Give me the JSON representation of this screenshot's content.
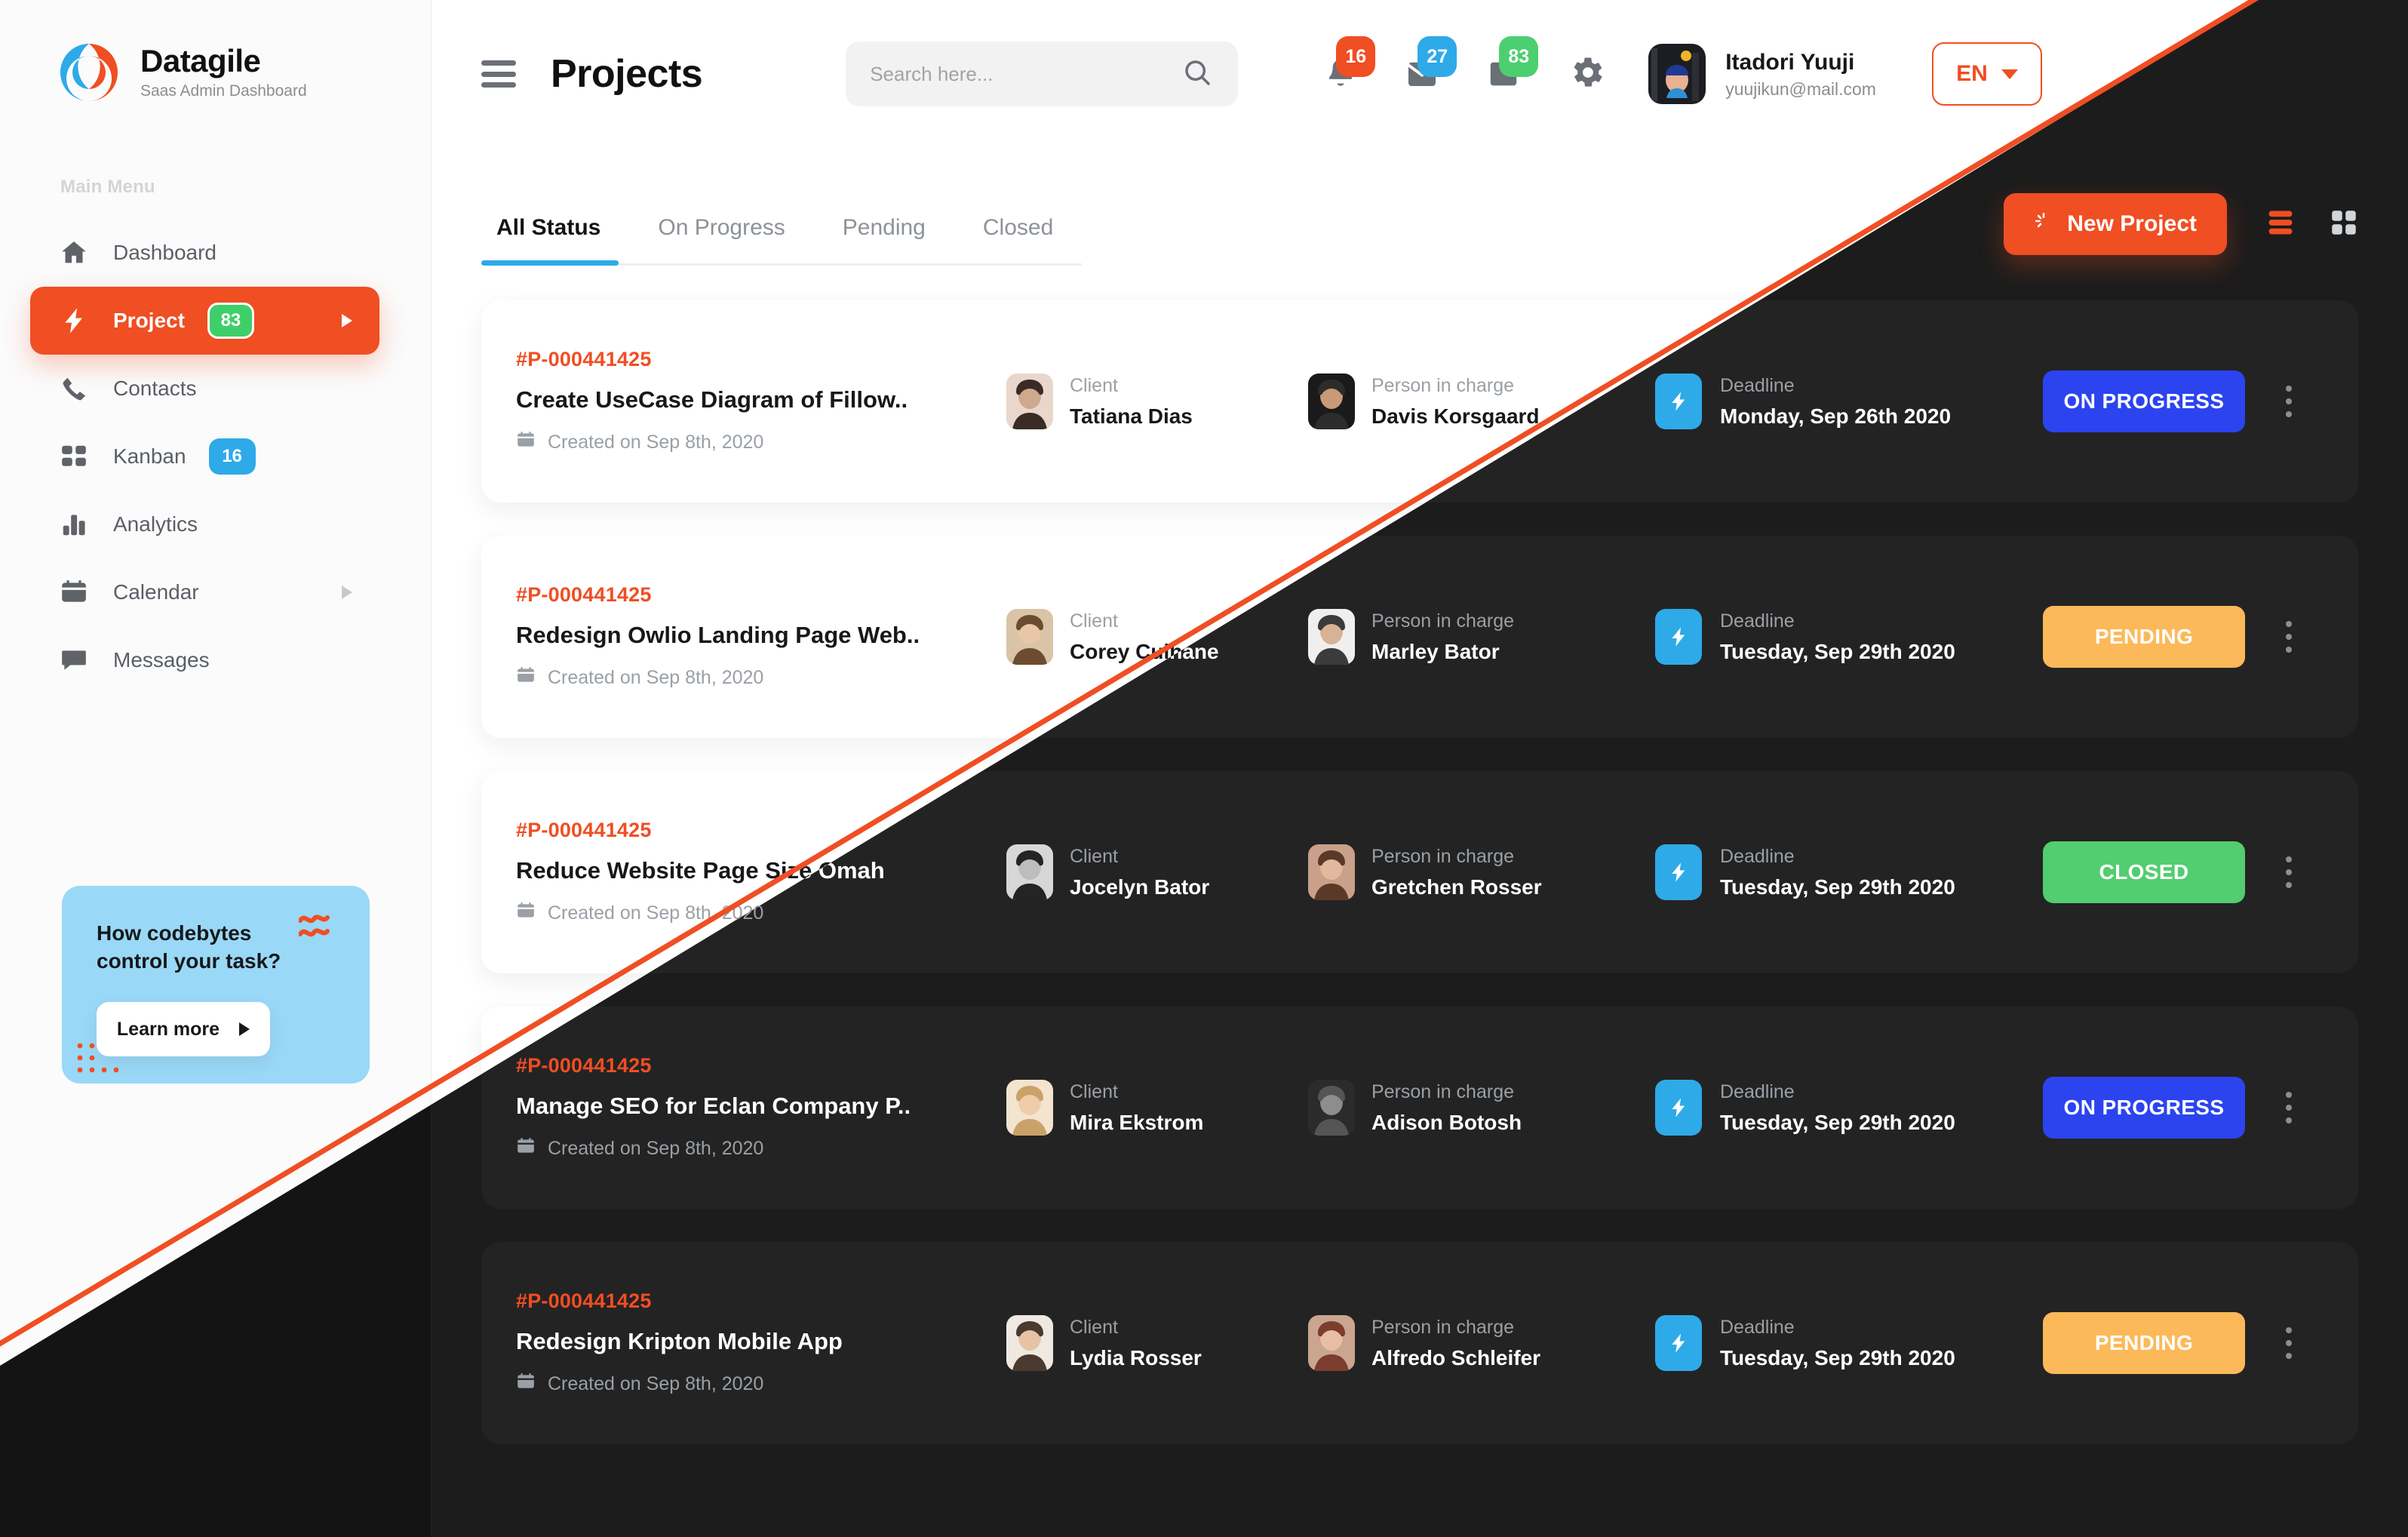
{
  "brand": {
    "name": "Datagile",
    "subtitle": "Saas Admin Dashboard"
  },
  "sidebar": {
    "section_label": "Main Menu",
    "items": [
      {
        "label": "Dashboard",
        "icon": "home-icon",
        "badge": null,
        "badge_color": null,
        "caret": false,
        "active": false
      },
      {
        "label": "Project",
        "icon": "bolt-icon",
        "badge": "83",
        "badge_color": "#3ecf6a",
        "caret": true,
        "active": true
      },
      {
        "label": "Contacts",
        "icon": "phone-icon",
        "badge": null,
        "badge_color": null,
        "caret": false,
        "active": false
      },
      {
        "label": "Kanban",
        "icon": "grid-icon",
        "badge": "16",
        "badge_color": "#2eaae8",
        "caret": false,
        "active": false
      },
      {
        "label": "Analytics",
        "icon": "bar-chart-icon",
        "badge": null,
        "badge_color": null,
        "caret": false,
        "active": false
      },
      {
        "label": "Calendar",
        "icon": "calendar-icon",
        "badge": null,
        "badge_color": null,
        "caret": true,
        "active": false
      },
      {
        "label": "Messages",
        "icon": "chat-icon",
        "badge": null,
        "badge_color": null,
        "caret": false,
        "active": false
      }
    ],
    "promo": {
      "title": "How codebytes control your task?",
      "button_label": "Learn more",
      "bg_color": "#9ad8f7"
    }
  },
  "header": {
    "title": "Projects",
    "search": {
      "value": "",
      "placeholder": "Search here..."
    },
    "icons": [
      {
        "name": "bell-icon",
        "count": "16",
        "color": "#f04e23"
      },
      {
        "name": "envelope-icon",
        "count": "27",
        "color": "#2eaae8"
      },
      {
        "name": "folder-icon",
        "count": "83",
        "color": "#4ccf71"
      }
    ],
    "settings_icon": "gear-icon",
    "user": {
      "name": "Itadori Yuuji",
      "email": "yuujikun@mail.com"
    },
    "language": {
      "code": "EN"
    }
  },
  "toolbar": {
    "tabs": [
      {
        "label": "All Status",
        "active": true
      },
      {
        "label": "On Progress",
        "active": false
      },
      {
        "label": "Pending",
        "active": false
      },
      {
        "label": "Closed",
        "active": false
      }
    ],
    "new_project_label": "New Project",
    "view_list_icon": "list-view-icon",
    "view_grid_icon": "grid-view-icon"
  },
  "labels": {
    "client": "Client",
    "person_in_charge": "Person in charge",
    "deadline": "Deadline",
    "created_prefix": "Created on"
  },
  "accent": {
    "orange": "#f04e23",
    "blue": "#2eaae8",
    "green": "#52cd6f",
    "amber": "#fcb95a",
    "indigo": "#2b44ef"
  },
  "projects": [
    {
      "id": "#P-000441425",
      "title": "Create UseCase Diagram of Fillow..",
      "created": "Created on Sep 8th, 2020",
      "client_role": "Client",
      "client": "Tatiana Dias",
      "charge_role": "Person in charge",
      "charge": "Davis Korsgaard",
      "deadline_label": "Deadline",
      "deadline": "Monday,  Sep 26th 2020",
      "status": "ON PROGRESS",
      "status_kind": "progress"
    },
    {
      "id": "#P-000441425",
      "title": "Redesign Owlio Landing Page Web..",
      "created": "Created on Sep 8th, 2020",
      "client_role": "Client",
      "client": "Corey Culhane",
      "charge_role": "Person in charge",
      "charge": "Marley Bator",
      "deadline_label": "Deadline",
      "deadline": "Tuesday,  Sep 29th 2020",
      "status": "PENDING",
      "status_kind": "pending"
    },
    {
      "id": "#P-000441425",
      "title": "Reduce Website Page Size Omah",
      "created": "Created on Sep 8th, 2020",
      "client_role": "Client",
      "client": "Jocelyn Bator",
      "charge_role": "Person in charge",
      "charge": "Gretchen Rosser",
      "deadline_label": "Deadline",
      "deadline": "Tuesday,  Sep 29th 2020",
      "status": "CLOSED",
      "status_kind": "closed"
    },
    {
      "id": "#P-000441425",
      "title": "Manage SEO for Eclan Company P..",
      "created": "Created on Sep 8th, 2020",
      "client_role": "Client",
      "client": "Mira Ekstrom",
      "charge_role": "Person in charge",
      "charge": "Adison Botosh",
      "deadline_label": "Deadline",
      "deadline": "Tuesday,  Sep 29th 2020",
      "status": "ON PROGRESS",
      "status_kind": "progress"
    },
    {
      "id": "#P-000441425",
      "title": "Redesign Kripton Mobile App",
      "created": "Created on Sep 8th, 2020",
      "client_role": "Client",
      "client": "Lydia Rosser",
      "charge_role": "Person in charge",
      "charge": "Alfredo Schleifer",
      "deadline_label": "Deadline",
      "deadline": "Tuesday,  Sep 29th 2020",
      "status": "PENDING",
      "status_kind": "pending"
    }
  ]
}
